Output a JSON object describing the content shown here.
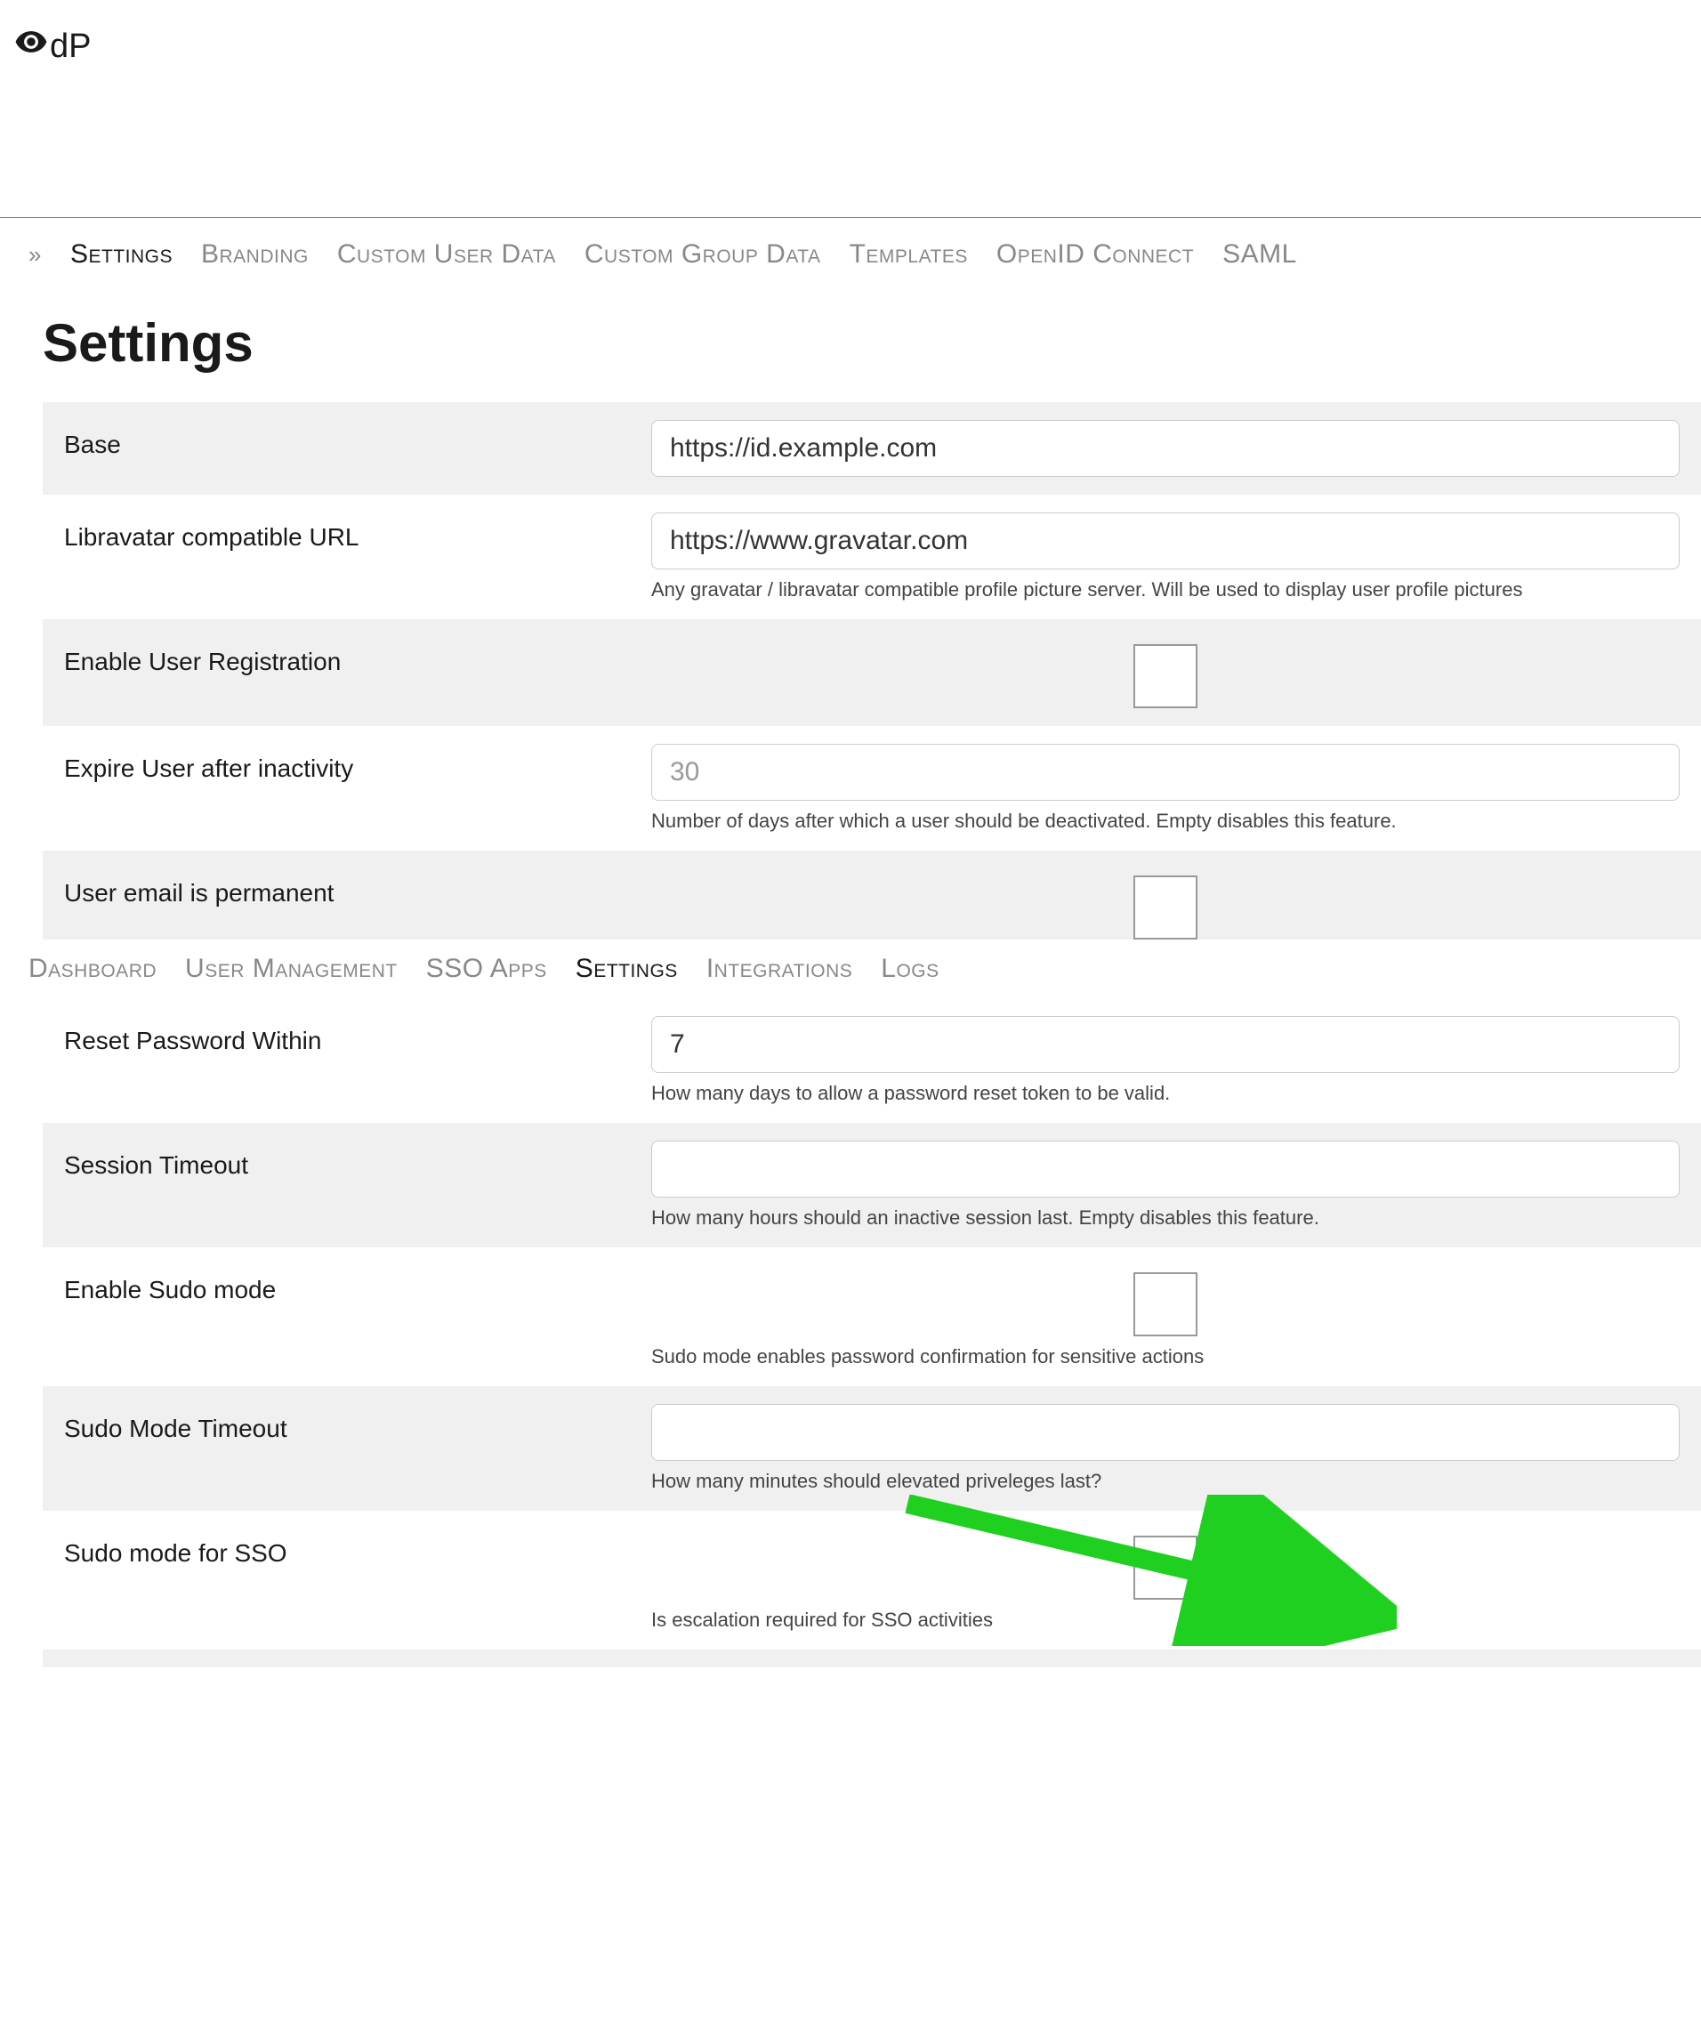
{
  "logo_text": "dP",
  "tabs_top": [
    {
      "label": "Settings",
      "active": true
    },
    {
      "label": "Branding",
      "active": false
    },
    {
      "label": "Custom User Data",
      "active": false
    },
    {
      "label": "Custom Group Data",
      "active": false
    },
    {
      "label": "Templates",
      "active": false
    },
    {
      "label": "OpenID Connect",
      "active": false
    },
    {
      "label": "SAML",
      "active": false
    }
  ],
  "tabs_mid": [
    {
      "label": "Dashboard",
      "active": false
    },
    {
      "label": "User Management",
      "active": false
    },
    {
      "label": "SSO Apps",
      "active": false
    },
    {
      "label": "Settings",
      "active": true
    },
    {
      "label": "Integrations",
      "active": false
    },
    {
      "label": "Logs",
      "active": false
    }
  ],
  "page_title": "Settings",
  "rows": {
    "base": {
      "label": "Base",
      "value": "https://id.example.com"
    },
    "libravatar": {
      "label": "Libravatar compatible URL",
      "value": "https://www.gravatar.com",
      "help": "Any gravatar / libravatar compatible profile picture server. Will be used to display user profile pictures"
    },
    "enable_reg": {
      "label": "Enable User Registration"
    },
    "expire": {
      "label": "Expire User after inactivity",
      "placeholder": "30",
      "help": "Number of days after which a user should be deactivated. Empty disables this feature."
    },
    "email_perm": {
      "label": "User email is permanent"
    },
    "reset_pw": {
      "label": "Reset Password Within",
      "value": "7",
      "help": "How many days to allow a password reset token to be valid."
    },
    "session_timeout": {
      "label": "Session Timeout",
      "value": "",
      "help": "How many hours should an inactive session last. Empty disables this feature."
    },
    "sudo_enable": {
      "label": "Enable Sudo mode",
      "help": "Sudo mode enables password confirmation for sensitive actions"
    },
    "sudo_timeout": {
      "label": "Sudo Mode Timeout",
      "value": "",
      "help": "How many minutes should elevated priveleges last?"
    },
    "sudo_sso": {
      "label": "Sudo mode for SSO",
      "help": "Is escalation required for SSO activities"
    }
  }
}
